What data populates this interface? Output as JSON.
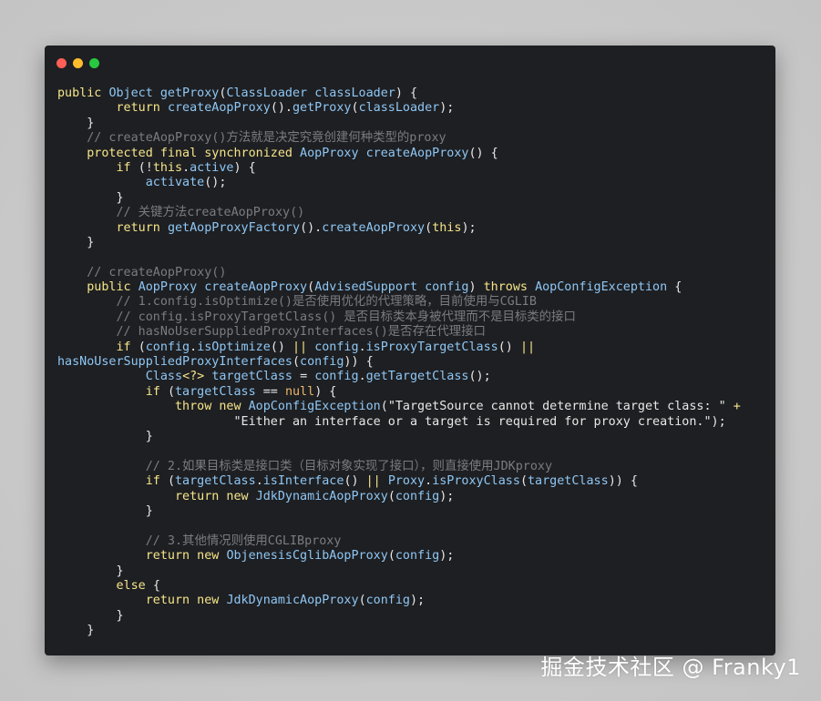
{
  "window": {
    "traffic_lights": [
      {
        "name": "close",
        "color": "#ff5f56"
      },
      {
        "name": "minimize",
        "color": "#ffbd2e"
      },
      {
        "name": "maximize",
        "color": "#27c93f"
      }
    ]
  },
  "code_lines": [
    [
      [
        "kw",
        "public "
      ],
      [
        "ty",
        "Object "
      ],
      [
        "fn",
        "getProxy"
      ],
      [
        "pl",
        "("
      ],
      [
        "ty",
        "ClassLoader "
      ],
      [
        "fn",
        "classLoader"
      ],
      [
        "pl",
        ") {"
      ]
    ],
    [
      [
        "pl",
        "        "
      ],
      [
        "kw",
        "return "
      ],
      [
        "fn",
        "createAopProxy"
      ],
      [
        "pl",
        "()."
      ],
      [
        "fn",
        "getProxy"
      ],
      [
        "pl",
        "("
      ],
      [
        "fn",
        "classLoader"
      ],
      [
        "pl",
        ");"
      ]
    ],
    [
      [
        "pl",
        "    }"
      ]
    ],
    [
      [
        "cm",
        "    // createAopProxy()方法就是决定究竟创建何种类型的proxy"
      ]
    ],
    [
      [
        "pl",
        "    "
      ],
      [
        "kw",
        "protected final synchronized "
      ],
      [
        "ty",
        "AopProxy "
      ],
      [
        "fn",
        "createAopProxy"
      ],
      [
        "pl",
        "() {"
      ]
    ],
    [
      [
        "pl",
        "        "
      ],
      [
        "kw",
        "if "
      ],
      [
        "pl",
        "(!"
      ],
      [
        "kw",
        "this"
      ],
      [
        "pl",
        "."
      ],
      [
        "fn",
        "active"
      ],
      [
        "pl",
        ") {"
      ]
    ],
    [
      [
        "pl",
        "            "
      ],
      [
        "fn",
        "activate"
      ],
      [
        "pl",
        "();"
      ]
    ],
    [
      [
        "pl",
        "        }"
      ]
    ],
    [
      [
        "cm",
        "        // 关键方法createAopProxy()"
      ]
    ],
    [
      [
        "pl",
        "        "
      ],
      [
        "kw",
        "return "
      ],
      [
        "fn",
        "getAopProxyFactory"
      ],
      [
        "pl",
        "()."
      ],
      [
        "fn",
        "createAopProxy"
      ],
      [
        "pl",
        "("
      ],
      [
        "kw",
        "this"
      ],
      [
        "pl",
        ");"
      ]
    ],
    [
      [
        "pl",
        "    }"
      ]
    ],
    [
      [
        "pl",
        ""
      ]
    ],
    [
      [
        "cm",
        "    // createAopProxy()"
      ]
    ],
    [
      [
        "pl",
        "    "
      ],
      [
        "kw",
        "public "
      ],
      [
        "ty",
        "AopProxy "
      ],
      [
        "fn",
        "createAopProxy"
      ],
      [
        "pl",
        "("
      ],
      [
        "ty",
        "AdvisedSupport "
      ],
      [
        "fn",
        "config"
      ],
      [
        "pl",
        ") "
      ],
      [
        "kw",
        "throws "
      ],
      [
        "ty",
        "AopConfigException "
      ],
      [
        "pl",
        "{"
      ]
    ],
    [
      [
        "cm",
        "        // 1.config.isOptimize()是否使用优化的代理策略，目前使用与CGLIB"
      ]
    ],
    [
      [
        "cm",
        "        // config.isProxyTargetClass() 是否目标类本身被代理而不是目标类的接口"
      ]
    ],
    [
      [
        "cm",
        "        // hasNoUserSuppliedProxyInterfaces()是否存在代理接口"
      ]
    ],
    [
      [
        "pl",
        "        "
      ],
      [
        "kw",
        "if "
      ],
      [
        "pl",
        "("
      ],
      [
        "fn",
        "config"
      ],
      [
        "pl",
        "."
      ],
      [
        "fn",
        "isOptimize"
      ],
      [
        "pl",
        "() "
      ],
      [
        "kw",
        "|| "
      ],
      [
        "fn",
        "config"
      ],
      [
        "pl",
        "."
      ],
      [
        "fn",
        "isProxyTargetClass"
      ],
      [
        "pl",
        "() "
      ],
      [
        "kw",
        "||"
      ]
    ],
    [
      [
        "fn",
        "hasNoUserSuppliedProxyInterfaces"
      ],
      [
        "pl",
        "("
      ],
      [
        "fn",
        "config"
      ],
      [
        "pl",
        ")) {"
      ]
    ],
    [
      [
        "pl",
        "            "
      ],
      [
        "ty",
        "Class"
      ],
      [
        "kw",
        "<?> "
      ],
      [
        "fn",
        "targetClass "
      ],
      [
        "pl",
        "= "
      ],
      [
        "fn",
        "config"
      ],
      [
        "pl",
        "."
      ],
      [
        "fn",
        "getTargetClass"
      ],
      [
        "pl",
        "();"
      ]
    ],
    [
      [
        "pl",
        "            "
      ],
      [
        "kw",
        "if "
      ],
      [
        "pl",
        "("
      ],
      [
        "fn",
        "targetClass "
      ],
      [
        "pl",
        "== "
      ],
      [
        "nu",
        "null"
      ],
      [
        "pl",
        ") {"
      ]
    ],
    [
      [
        "pl",
        "                "
      ],
      [
        "kw",
        "throw new "
      ],
      [
        "ty",
        "AopConfigException"
      ],
      [
        "pl",
        "("
      ],
      [
        "st",
        "\"TargetSource cannot determine target class: \" "
      ],
      [
        "kw",
        "+"
      ]
    ],
    [
      [
        "pl",
        "                        "
      ],
      [
        "st",
        "\"Either an interface or a target is required for proxy creation.\""
      ],
      [
        "pl",
        ");"
      ]
    ],
    [
      [
        "pl",
        "            }"
      ]
    ],
    [
      [
        "pl",
        ""
      ]
    ],
    [
      [
        "cm",
        "            // 2.如果目标类是接口类（目标对象实现了接口），则直接使用JDKproxy"
      ]
    ],
    [
      [
        "pl",
        "            "
      ],
      [
        "kw",
        "if "
      ],
      [
        "pl",
        "("
      ],
      [
        "fn",
        "targetClass"
      ],
      [
        "pl",
        "."
      ],
      [
        "fn",
        "isInterface"
      ],
      [
        "pl",
        "() "
      ],
      [
        "kw",
        "|| "
      ],
      [
        "ty",
        "Proxy"
      ],
      [
        "pl",
        "."
      ],
      [
        "fn",
        "isProxyClass"
      ],
      [
        "pl",
        "("
      ],
      [
        "fn",
        "targetClass"
      ],
      [
        "pl",
        ")) {"
      ]
    ],
    [
      [
        "pl",
        "                "
      ],
      [
        "kw",
        "return new "
      ],
      [
        "ty",
        "JdkDynamicAopProxy"
      ],
      [
        "pl",
        "("
      ],
      [
        "fn",
        "config"
      ],
      [
        "pl",
        ");"
      ]
    ],
    [
      [
        "pl",
        "            }"
      ]
    ],
    [
      [
        "pl",
        ""
      ]
    ],
    [
      [
        "cm",
        "            // 3.其他情况则使用CGLIBproxy"
      ]
    ],
    [
      [
        "pl",
        "            "
      ],
      [
        "kw",
        "return new "
      ],
      [
        "ty",
        "ObjenesisCglibAopProxy"
      ],
      [
        "pl",
        "("
      ],
      [
        "fn",
        "config"
      ],
      [
        "pl",
        ");"
      ]
    ],
    [
      [
        "pl",
        "        }"
      ]
    ],
    [
      [
        "pl",
        "        "
      ],
      [
        "kw",
        "else "
      ],
      [
        "pl",
        "{"
      ]
    ],
    [
      [
        "pl",
        "            "
      ],
      [
        "kw",
        "return new "
      ],
      [
        "ty",
        "JdkDynamicAopProxy"
      ],
      [
        "pl",
        "("
      ],
      [
        "fn",
        "config"
      ],
      [
        "pl",
        ");"
      ]
    ],
    [
      [
        "pl",
        "        }"
      ]
    ],
    [
      [
        "pl",
        "    }"
      ]
    ]
  ],
  "watermark": "掘金技术社区 @ Franky1"
}
